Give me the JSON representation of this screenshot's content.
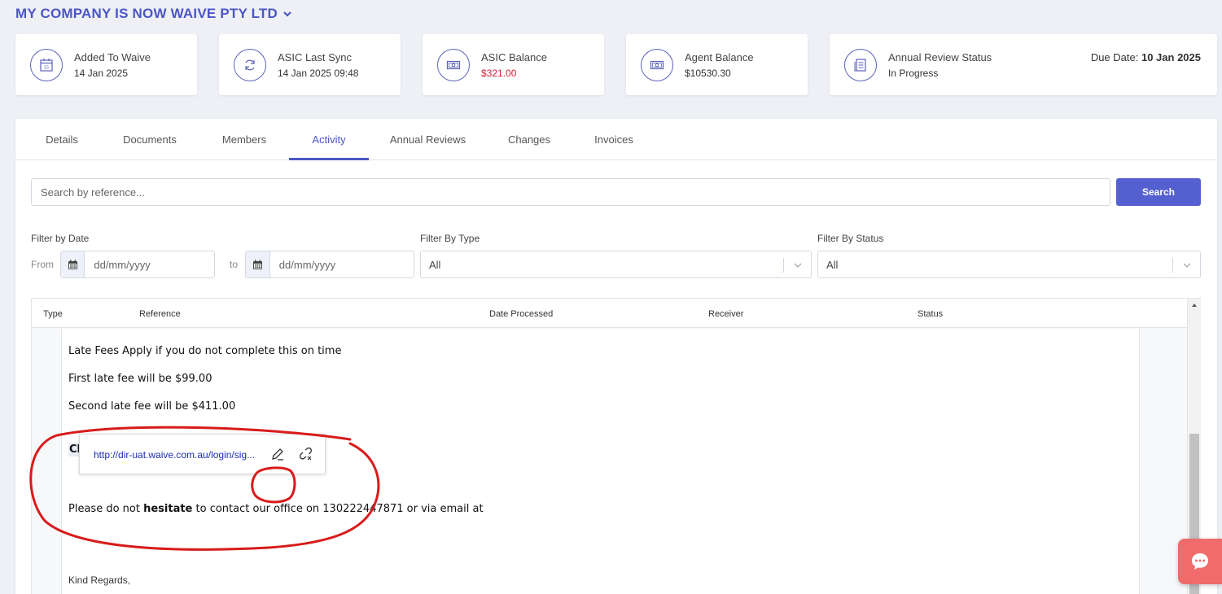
{
  "company": {
    "name": "MY COMPANY IS NOW WAIVE PTY LTD"
  },
  "cards": [
    {
      "title": "Added To Waive",
      "value": "14 Jan 2025",
      "icon": "calendar-icon"
    },
    {
      "title": "ASIC Last Sync",
      "value": "14 Jan 2025 09:48",
      "icon": "sync-icon"
    },
    {
      "title": "ASIC Balance",
      "value": "$321.00",
      "icon": "money-icon",
      "value_color": "#d01f36"
    },
    {
      "title": "Agent Balance",
      "value": "$10530.30",
      "icon": "money-icon"
    },
    {
      "title": "Annual Review Status",
      "value": "In Progress",
      "icon": "document-icon",
      "due_label": "Due Date:",
      "due_value": "10 Jan 2025"
    }
  ],
  "tabs": [
    "Details",
    "Documents",
    "Members",
    "Activity",
    "Annual Reviews",
    "Changes",
    "Invoices"
  ],
  "active_tab": "Activity",
  "search": {
    "placeholder": "Search by reference...",
    "button": "Search"
  },
  "filters": {
    "date_label": "Filter by Date",
    "from_label": "From",
    "to_label": "to",
    "date_placeholder": "dd/mm/yyyy",
    "type_label": "Filter By Type",
    "type_value": "All",
    "status_label": "Filter By Status",
    "status_value": "All"
  },
  "table": {
    "headers": [
      "Type",
      "Reference",
      "Date Processed",
      "Receiver",
      "Status"
    ]
  },
  "editor": {
    "lines": [
      "Late Fees Apply if you do not complete this on time",
      "First late fee will be $99.00",
      "Second late fee will be $411.00"
    ],
    "link_text": "Click Here",
    "link_url": "http://dir-uat.waive.com.au/login/sig...",
    "contact_before": "Please do not ",
    "contact_bold": "hesitate",
    "contact_after": " to contact our office on 130222447871 or via email at",
    "sign_off": "Kind Regards,"
  },
  "colors": {
    "accent": "#4b56c4",
    "button": "#5560d0",
    "annotation": "#d81b1b",
    "chat": "#f06b6b"
  }
}
